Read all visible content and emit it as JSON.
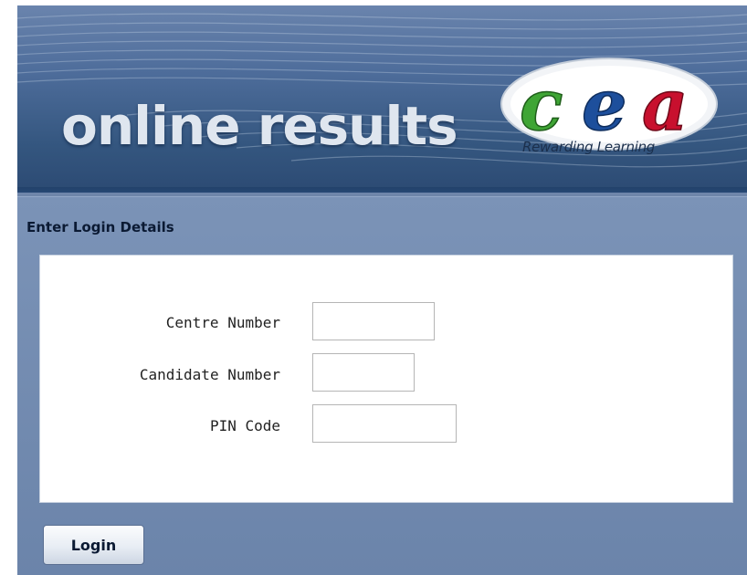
{
  "banner": {
    "title": "online results",
    "logo_text": "cea",
    "logo_tagline": "Rewarding Learning"
  },
  "login_panel": {
    "heading": "Enter Login Details",
    "fields": [
      {
        "label": "Centre Number",
        "value": ""
      },
      {
        "label": "Candidate Number",
        "value": ""
      },
      {
        "label": "PIN Code",
        "value": ""
      }
    ],
    "submit_label": "Login"
  },
  "colors": {
    "banner_top": "#6a84ad",
    "banner_bottom": "#2c4a73",
    "panel_bg": "#7088ad",
    "logo_green": "#3fa535",
    "logo_blue": "#1d4f9c",
    "logo_red": "#c8102e"
  }
}
